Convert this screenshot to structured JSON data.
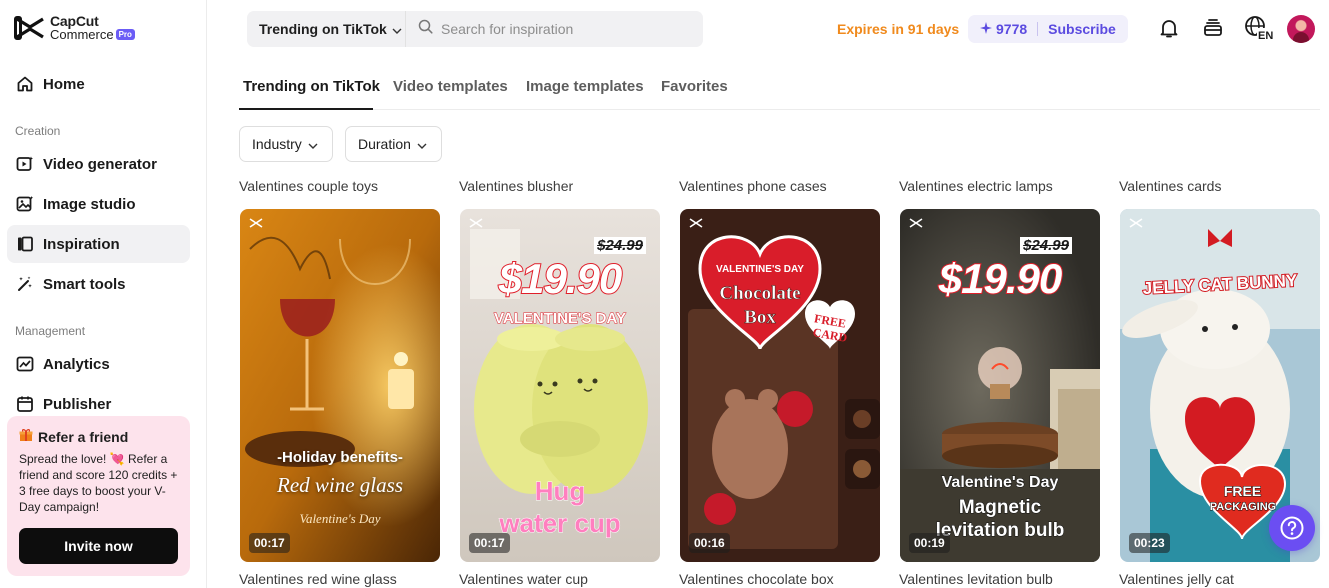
{
  "brand": {
    "line1": "CapCut",
    "line2": "Commerce",
    "badge": "Pro"
  },
  "sidebar": {
    "home": "Home",
    "creation_label": "Creation",
    "creation_items": [
      "Video generator",
      "Image studio",
      "Inspiration",
      "Smart tools"
    ],
    "management_label": "Management",
    "management_items": [
      "Analytics",
      "Publisher"
    ],
    "active_item": "Inspiration"
  },
  "refer": {
    "title": "Refer a friend",
    "text": "Spread the love! 💘 Refer a friend and score 120 credits + 3 free days to boost your V-Day campaign!",
    "button": "Invite now"
  },
  "topbar": {
    "source": "Trending on TikTok",
    "search_placeholder": "Search for inspiration",
    "expires": "Expires in 91 days",
    "credits": "9778",
    "subscribe": "Subscribe",
    "language": "EN"
  },
  "tabs": [
    "Trending on TikTok",
    "Video templates",
    "Image templates",
    "Favorites"
  ],
  "filters": [
    "Industry",
    "Duration"
  ],
  "cards": [
    {
      "title": "Valentines couple toys",
      "caption": "Valentines red wine glass",
      "duration": "00:17",
      "overlay": [
        "-Holiday benefits-",
        "Red wine glass",
        "Valentine's Day"
      ]
    },
    {
      "title": "Valentines blusher",
      "caption": "Valentines water cup",
      "duration": "00:17",
      "overlay": [
        "$24.99",
        "$19.90",
        "VALENTINE'S DAY",
        "Hug",
        "water cup"
      ]
    },
    {
      "title": "Valentines phone cases",
      "caption": "Valentines chocolate box",
      "duration": "00:16",
      "overlay": [
        "VALENTINE'S DAY",
        "Chocolate",
        "Box",
        "FREE",
        "CARD"
      ]
    },
    {
      "title": "Valentines electric lamps",
      "caption": "Valentines levitation bulb",
      "duration": "00:19",
      "overlay": [
        "$24.99",
        "$19.90",
        "Valentine's Day",
        "Magnetic",
        "levitation bulb"
      ]
    },
    {
      "title": "Valentines cards",
      "caption": "Valentines jelly cat",
      "duration": "00:23",
      "overlay": [
        "JELLY CAT BUNNY",
        "FREE",
        "PACKAGING"
      ]
    }
  ],
  "colors": {
    "accent": "#6b4ef2",
    "expires": "#f08a1d",
    "credits": "#5b4be0"
  }
}
